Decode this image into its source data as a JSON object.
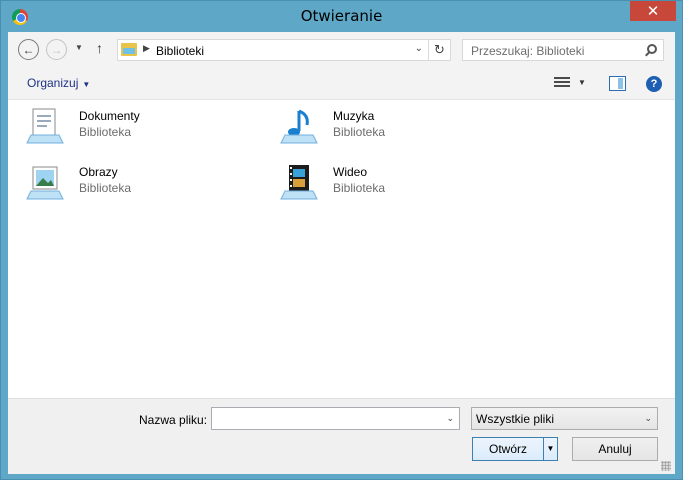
{
  "window": {
    "title": "Otwieranie",
    "close_glyph": "✕"
  },
  "nav": {
    "back_glyph": "←",
    "forward_glyph": "→",
    "recent_glyph": "▼",
    "up_glyph": "↑",
    "address_chevron": "▶",
    "address": "Biblioteki",
    "address_dropdown_glyph": "⌄",
    "refresh_glyph": "↻",
    "search_placeholder": "Przeszukaj: Biblioteki"
  },
  "toolbar": {
    "organize_label": "Organizuj",
    "organize_caret": "▼",
    "view_caret": "▼",
    "help_glyph": "?"
  },
  "libraries": [
    {
      "name": "Dokumenty",
      "type": "Biblioteka",
      "icon": "documents-library-icon"
    },
    {
      "name": "Muzyka",
      "type": "Biblioteka",
      "icon": "music-library-icon"
    },
    {
      "name": "Obrazy",
      "type": "Biblioteka",
      "icon": "pictures-library-icon"
    },
    {
      "name": "Wideo",
      "type": "Biblioteka",
      "icon": "videos-library-icon"
    }
  ],
  "footer": {
    "filename_label": "Nazwa pliku:",
    "filename_value": "",
    "filename_caret": "⌄",
    "filter_value": "Wszystkie pliki",
    "filter_caret": "⌄",
    "open_label": "Otwórz",
    "open_split_glyph": "▼",
    "cancel_label": "Anuluj"
  },
  "colors": {
    "frame": "#5ea7c6",
    "close": "#c7483a",
    "link": "#1e3287"
  }
}
